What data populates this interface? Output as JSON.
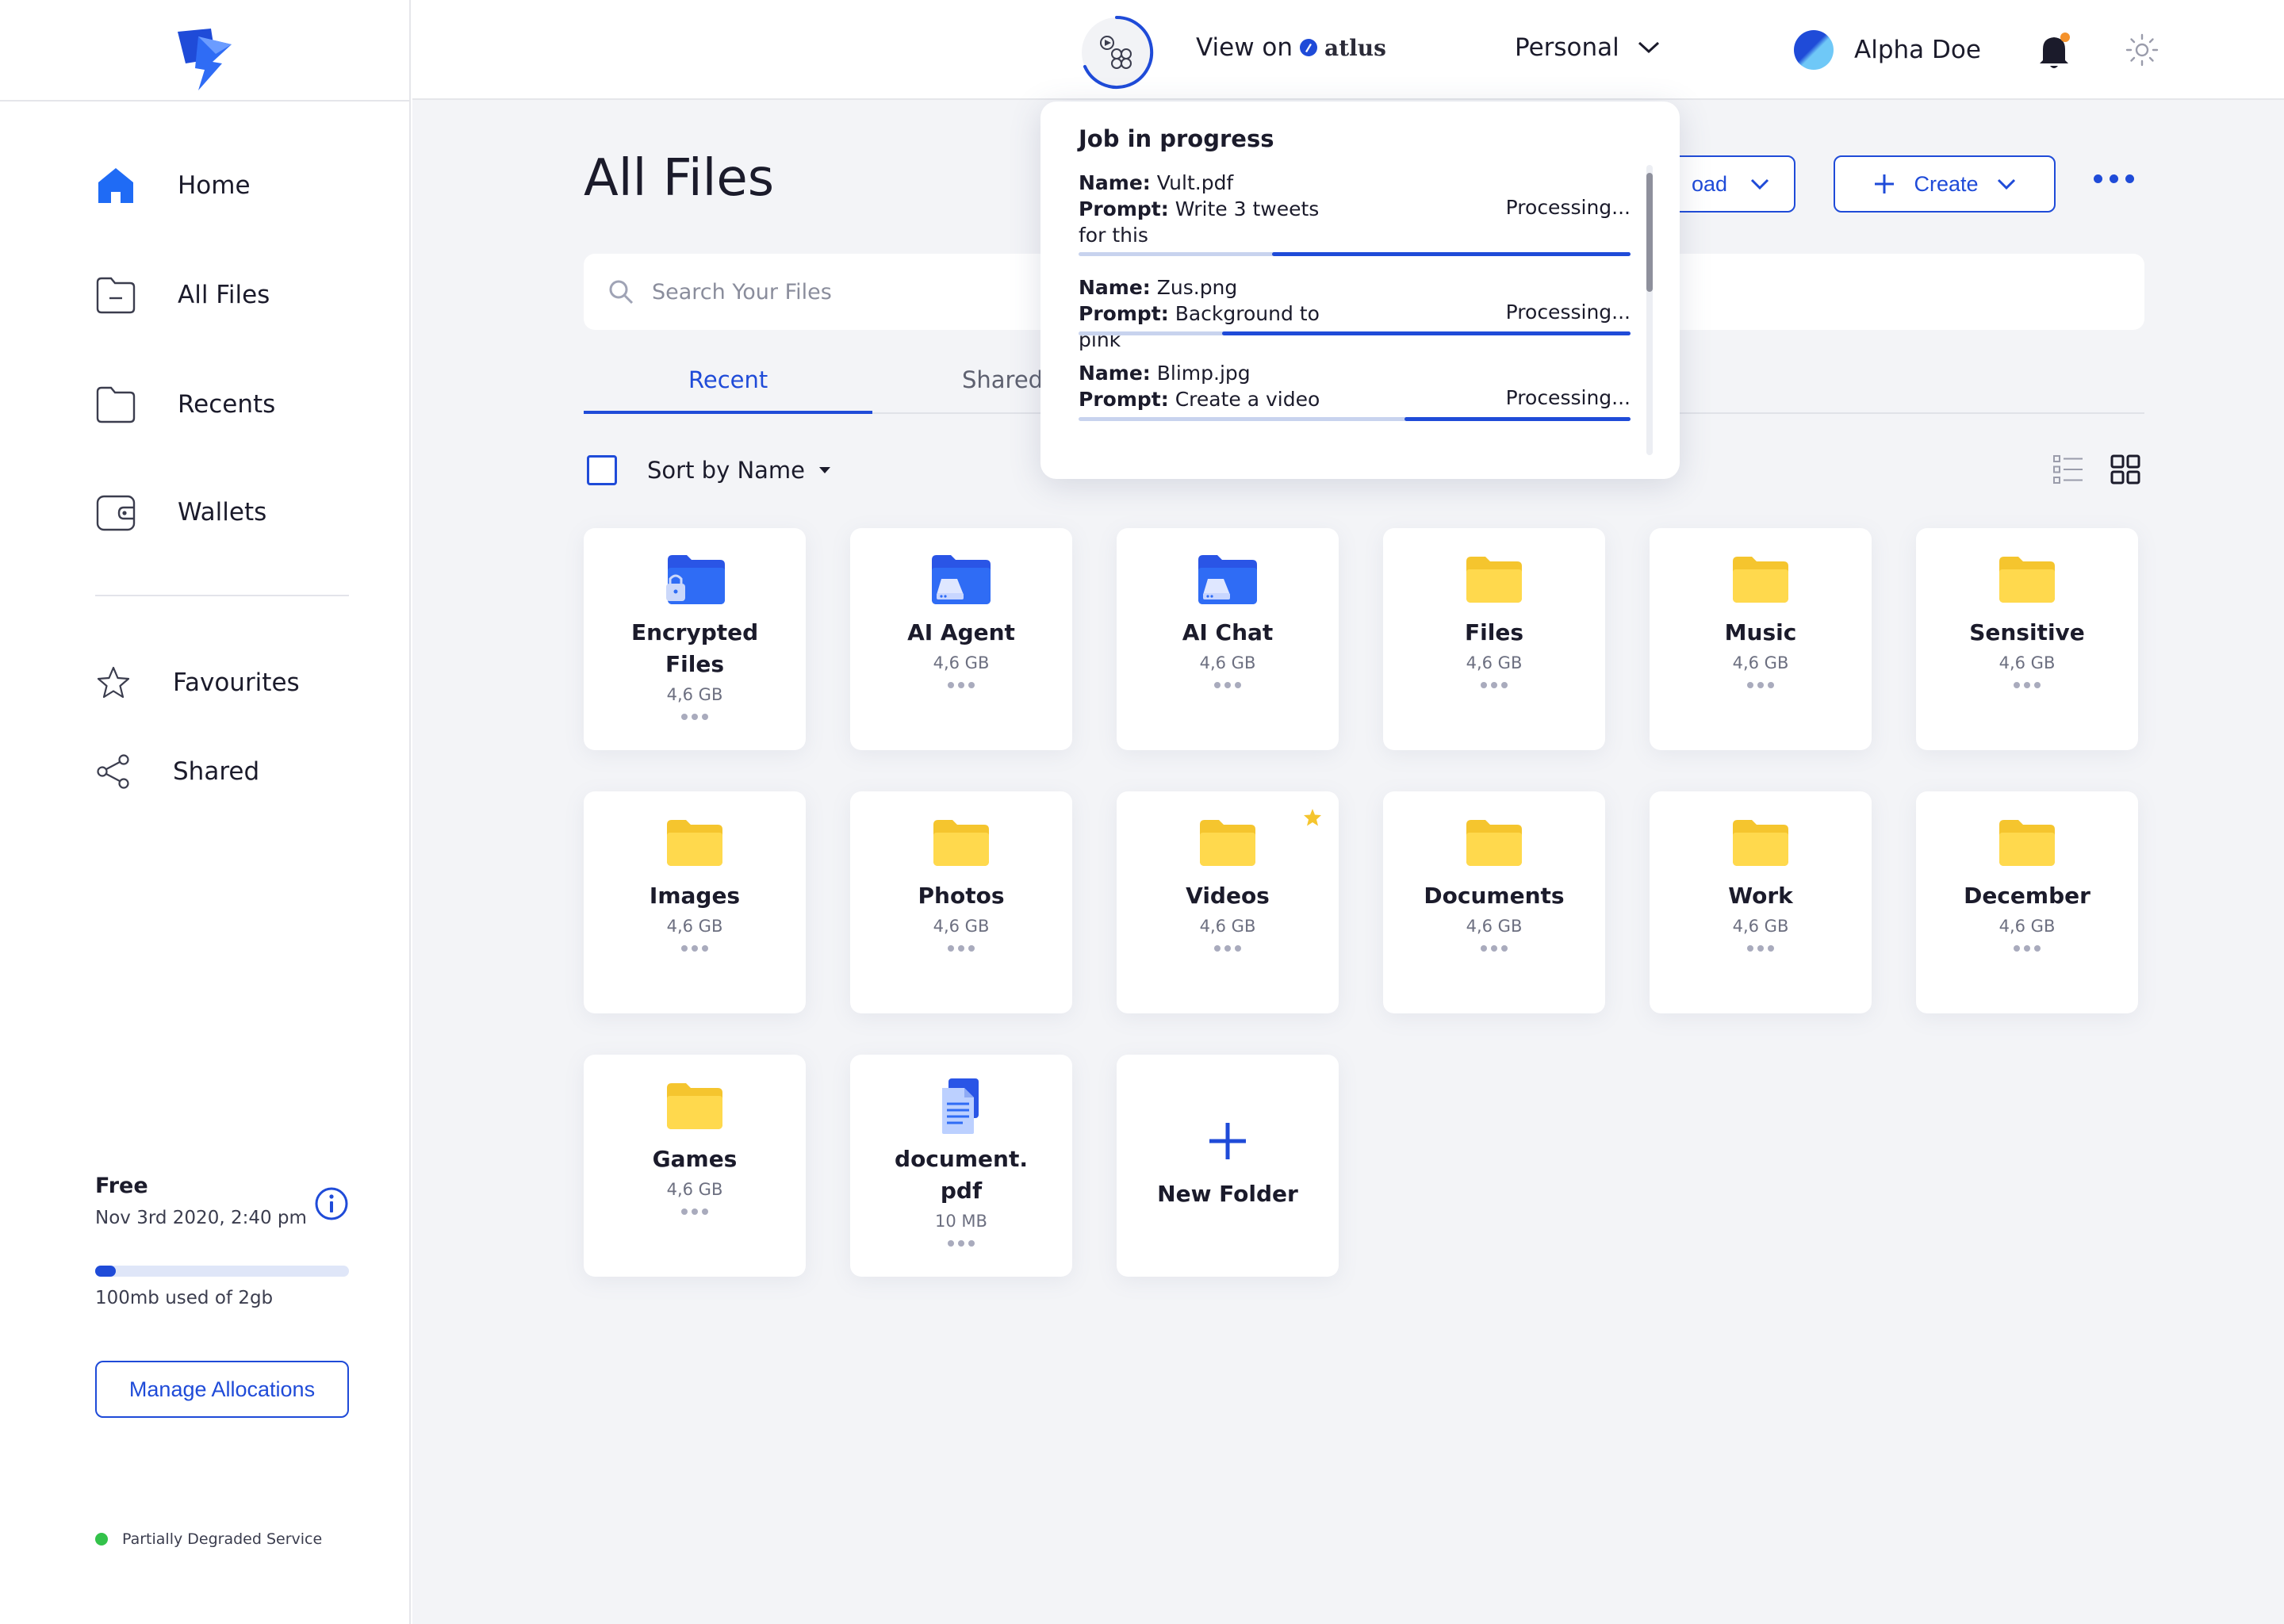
{
  "topbar": {
    "view_on_label": "View on",
    "view_on_brand": "atlus",
    "workspace": "Personal",
    "user_name": "Alpha Doe"
  },
  "sidebar": {
    "items": [
      {
        "label": "Home",
        "icon": "home-icon"
      },
      {
        "label": "All Files",
        "icon": "folder-icon"
      },
      {
        "label": "Recents",
        "icon": "folder-outline-icon"
      },
      {
        "label": "Wallets",
        "icon": "wallet-icon"
      }
    ],
    "secondary": [
      {
        "label": "Favourites",
        "icon": "star-icon"
      },
      {
        "label": "Shared",
        "icon": "share-icon"
      }
    ],
    "plan": {
      "name": "Free",
      "date": "Nov 3rd 2020, 2:40 pm",
      "usage_text": "100mb used of 2gb",
      "usage_fraction": 0.08
    },
    "manage_label": "Manage Allocations",
    "status_text": "Partially Degraded Service"
  },
  "main": {
    "title": "All Files",
    "upload_label": "oad",
    "create_label": "Create",
    "search_placeholder": "Search Your Files",
    "tabs": [
      {
        "label": "Recent"
      },
      {
        "label": "Shared"
      }
    ],
    "sort_label": "Sort by Name",
    "cards": [
      {
        "name": "Encrypted Files",
        "size": "4,6 GB",
        "icon": "encrypted-folder-icon"
      },
      {
        "name": "AI Agent",
        "size": "4,6 GB",
        "icon": "drive-folder-icon"
      },
      {
        "name": "AI Chat",
        "size": "4,6 GB",
        "icon": "drive-folder-icon"
      },
      {
        "name": "Files",
        "size": "4,6 GB",
        "icon": "folder-icon"
      },
      {
        "name": "Music",
        "size": "4,6 GB",
        "icon": "folder-icon"
      },
      {
        "name": "Sensitive",
        "size": "4,6 GB",
        "icon": "folder-icon"
      },
      {
        "name": "Images",
        "size": "4,6 GB",
        "icon": "folder-icon"
      },
      {
        "name": "Photos",
        "size": "4,6 GB",
        "icon": "folder-icon"
      },
      {
        "name": "Videos",
        "size": "4,6 GB",
        "icon": "folder-icon",
        "starred": true
      },
      {
        "name": "Documents",
        "size": "4,6 GB",
        "icon": "folder-icon"
      },
      {
        "name": "Work",
        "size": "4,6 GB",
        "icon": "folder-icon"
      },
      {
        "name": "December",
        "size": "4,6 GB",
        "icon": "folder-icon"
      },
      {
        "name": "Games",
        "size": "4,6 GB",
        "icon": "folder-icon"
      },
      {
        "name": "document.\npdf",
        "size": "10 MB",
        "icon": "document-icon"
      },
      {
        "name": "New Folder",
        "icon": "plus-icon"
      }
    ]
  },
  "popup": {
    "title": "Job in progress",
    "name_label": "Name:",
    "prompt_label": "Prompt:",
    "jobs": [
      {
        "name": "Vult.pdf",
        "prompt": "Write 3 tweets for this",
        "status": "Processing...",
        "progress": 0.65
      },
      {
        "name": "Zus.png",
        "prompt": "Background to pink",
        "status": "Processing...",
        "progress": 0.74
      },
      {
        "name": "Blimp.jpg",
        "prompt": "Create a video",
        "status": "Processing...",
        "progress": 0.41
      }
    ]
  },
  "colors": {
    "accent": "#1f4bd8",
    "folder": "#ffd74a",
    "status_ok": "#33c24a",
    "notification": "#f5922b"
  }
}
